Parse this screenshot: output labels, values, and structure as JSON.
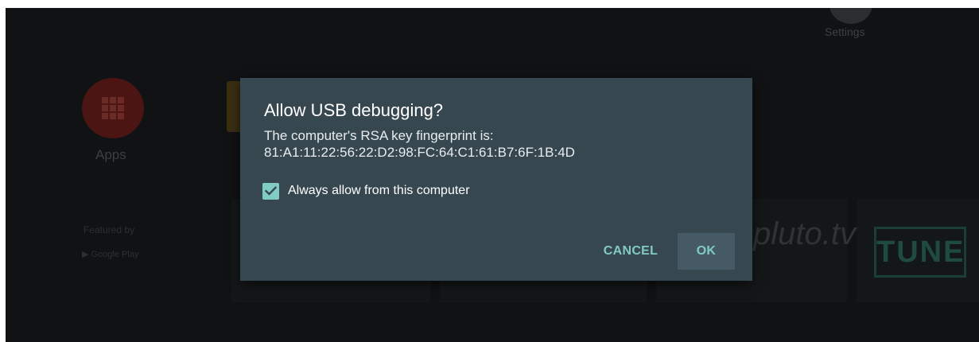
{
  "background": {
    "settings_label": "Settings",
    "apps_label": "Apps",
    "featured_label": "Featured by",
    "google_play_label": "Google Play",
    "pluto_logo_text": "pluto.tv",
    "tune_logo_text": "TUNE"
  },
  "dialog": {
    "title": "Allow USB debugging?",
    "message_line1": "The computer's RSA key fingerprint is:",
    "fingerprint": "81:A1:11:22:56:22:D2:98:FC:64:C1:61:B7:6F:1B:4D",
    "checkbox": {
      "label": "Always allow from this computer",
      "checked": true
    },
    "buttons": {
      "cancel": "CANCEL",
      "ok": "OK"
    }
  },
  "colors": {
    "dialog_bg": "#37474f",
    "accent": "#80cbc4",
    "ok_button_bg": "#455a64",
    "screen_bg": "#101213"
  },
  "icons": {
    "settings": "gear-icon",
    "apps": "apps-grid-icon",
    "checkbox": "check-icon",
    "google_play": "play-store-icon"
  }
}
